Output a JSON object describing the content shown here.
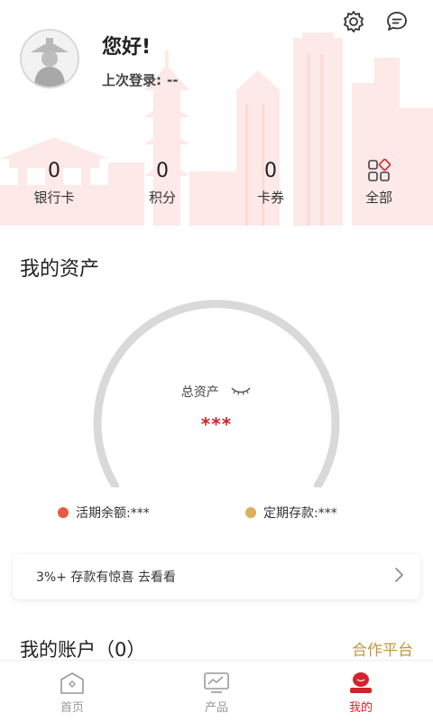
{
  "header": {
    "greeting": "您好!",
    "last_login_label": "上次登录:",
    "last_login_value": "--",
    "icons": [
      "settings-icon",
      "message-icon"
    ]
  },
  "stats": [
    {
      "value": "0",
      "label": "银行卡"
    },
    {
      "value": "0",
      "label": "积分"
    },
    {
      "value": "0",
      "label": "卡券"
    },
    {
      "value": "",
      "label": "全部",
      "icon": "grid-icon"
    }
  ],
  "assets": {
    "title": "我的资产",
    "total_label": "总资产",
    "total_value": "***",
    "legend": [
      {
        "label": "活期余额:***",
        "color": "#e85a3f"
      },
      {
        "label": "定期存款:***",
        "color": "#d9b15f"
      }
    ]
  },
  "promo": {
    "text": "3%+ 存款有惊喜 去看看"
  },
  "accounts": {
    "title": "我的账户（0）",
    "partner_link": "合作平台"
  },
  "tabbar": [
    {
      "label": "首页",
      "icon": "home-icon",
      "active": false
    },
    {
      "label": "产品",
      "icon": "chart-monitor-icon",
      "active": false
    },
    {
      "label": "我的",
      "icon": "profile-icon",
      "active": true
    }
  ],
  "colors": {
    "brand_red": "#d3232c",
    "gold": "#c2963a",
    "gauge_track": "#d9d9d9"
  }
}
